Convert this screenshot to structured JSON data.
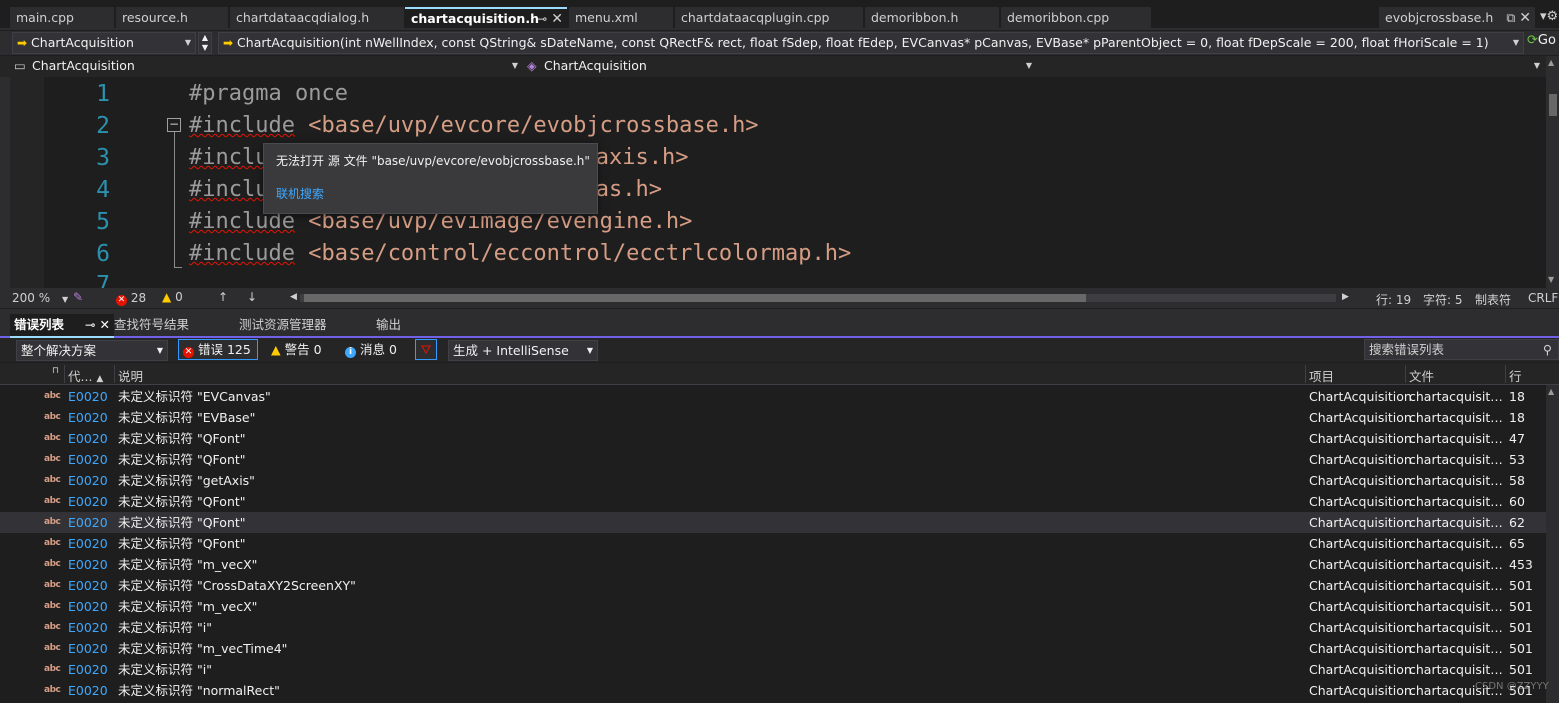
{
  "tabs": [
    "main.cpp",
    "resource.h",
    "chartdataacqdialog.h",
    "chartacquisition.h",
    "menu.xml",
    "chartdataacqplugin.cpp",
    "demoribbon.h",
    "demoribbon.cpp"
  ],
  "right_tab": "evobjcrossbase.h",
  "nav": {
    "project_combo": "ChartAcquisition",
    "member_combo": "ChartAcquisition(int nWellIndex, const QString& sDateName, const QRectF& rect, float fSdep, float fEdep, EVCanvas* pCanvas, EVBase* pParentObject = 0, float fDepScale = 200, float fHoriScale = 1)",
    "go_label": "Go",
    "scope_combo": "ChartAcquisition",
    "symbol_combo": "ChartAcquisition"
  },
  "editor": {
    "line_numbers": [
      "1",
      "2",
      "3",
      "4",
      "5",
      "6",
      "7"
    ],
    "line1": "#pragma once",
    "line2_kw": "#include",
    "line2_path": "<base/uvp/evcore/evobjcrossbase.h>",
    "line3_kw": "#inclu",
    "line3_path": "paxis.h>",
    "line4_kw": "#inclu",
    "line4_path": "vas.h>",
    "line5_kw": "#include",
    "line5_path": "<base/uvp/evimage/evengine.h>",
    "line6_kw": "#include",
    "line6_path": "<base/control/eccontrol/ecctrlcolormap.h>",
    "tooltip_message": "无法打开 源 文件 \"base/uvp/evcore/evobjcrossbase.h\"",
    "tooltip_link": "联机搜索"
  },
  "status": {
    "zoom": "200 %",
    "errors": "28",
    "warnings": "0",
    "line": "行: 19",
    "char": "字符: 5",
    "tabs": "制表符",
    "eol": "CRLF"
  },
  "panel_tabs": [
    "错误列表",
    "查找符号结果",
    "测试资源管理器",
    "输出"
  ],
  "filters": {
    "scope": "整个解决方案",
    "errors": "错误 125",
    "warnings": "警告 0",
    "messages": "消息 0",
    "source": "生成 + IntelliSense",
    "search_placeholder": "搜索错误列表"
  },
  "columns": {
    "code": "代...",
    "desc": "说明",
    "project": "项目",
    "file": "文件",
    "line": "行"
  },
  "rows": [
    {
      "code": "E0020",
      "desc": "未定义标识符 \"EVCanvas\"",
      "project": "ChartAcquisition",
      "file": "chartacquisitio...",
      "line": "18"
    },
    {
      "code": "E0020",
      "desc": "未定义标识符 \"EVBase\"",
      "project": "ChartAcquisition",
      "file": "chartacquisitio...",
      "line": "18"
    },
    {
      "code": "E0020",
      "desc": "未定义标识符 \"QFont\"",
      "project": "ChartAcquisition",
      "file": "chartacquisitio...",
      "line": "47"
    },
    {
      "code": "E0020",
      "desc": "未定义标识符 \"QFont\"",
      "project": "ChartAcquisition",
      "file": "chartacquisitio...",
      "line": "53"
    },
    {
      "code": "E0020",
      "desc": "未定义标识符 \"getAxis\"",
      "project": "ChartAcquisition",
      "file": "chartacquisitio...",
      "line": "58"
    },
    {
      "code": "E0020",
      "desc": "未定义标识符 \"QFont\"",
      "project": "ChartAcquisition",
      "file": "chartacquisitio...",
      "line": "60"
    },
    {
      "code": "E0020",
      "desc": "未定义标识符 \"QFont\"",
      "project": "ChartAcquisition",
      "file": "chartacquisitio...",
      "line": "62"
    },
    {
      "code": "E0020",
      "desc": "未定义标识符 \"QFont\"",
      "project": "ChartAcquisition",
      "file": "chartacquisitio...",
      "line": "65"
    },
    {
      "code": "E0020",
      "desc": "未定义标识符 \"m_vecX\"",
      "project": "ChartAcquisition",
      "file": "chartacquisitio...",
      "line": "453"
    },
    {
      "code": "E0020",
      "desc": "未定义标识符 \"CrossDataXY2ScreenXY\"",
      "project": "ChartAcquisition",
      "file": "chartacquisitio...",
      "line": "501"
    },
    {
      "code": "E0020",
      "desc": "未定义标识符 \"m_vecX\"",
      "project": "ChartAcquisition",
      "file": "chartacquisitio...",
      "line": "501"
    },
    {
      "code": "E0020",
      "desc": "未定义标识符 \"i\"",
      "project": "ChartAcquisition",
      "file": "chartacquisitio...",
      "line": "501"
    },
    {
      "code": "E0020",
      "desc": "未定义标识符 \"m_vecTime4\"",
      "project": "ChartAcquisition",
      "file": "chartacquisitio...",
      "line": "501"
    },
    {
      "code": "E0020",
      "desc": "未定义标识符 \"i\"",
      "project": "ChartAcquisition",
      "file": "chartacquisitio...",
      "line": "501"
    },
    {
      "code": "E0020",
      "desc": "未定义标识符 \"normalRect\"",
      "project": "ChartAcquisition",
      "file": "chartacquisitio...",
      "line": "501"
    }
  ],
  "watermark": "CSDN @ZZYYY",
  "colors": {
    "accent": "#7160e8",
    "error": "#e51400",
    "link": "#3ea8ff",
    "path": "#d69d85",
    "line_number": "#2b91af"
  }
}
